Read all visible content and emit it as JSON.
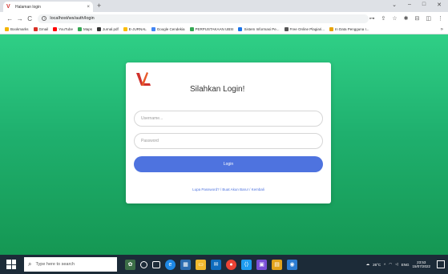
{
  "browser": {
    "tab_title": "Halaman login",
    "tab_close": "×",
    "new_tab": "+",
    "url": "localhost/ws/auth/login",
    "window_controls": [
      "⌄",
      "–",
      "□",
      "✕"
    ],
    "nav": {
      "back": "←",
      "forward": "→",
      "reload": "C"
    },
    "addr_icons": [
      "⊶",
      "⇪",
      "☆",
      "✱",
      "⊟",
      "◫",
      "⋮"
    ]
  },
  "bookmarks": [
    {
      "label": "Bookmarks",
      "color": "#f4b400"
    },
    {
      "label": "Gmail",
      "color": "#d93025"
    },
    {
      "label": "YouTube",
      "color": "#ff0000"
    },
    {
      "label": "Maps",
      "color": "#34a853"
    },
    {
      "label": "Jurnal.pdf",
      "color": "#333333"
    },
    {
      "label": "E-JURNAL",
      "color": "#fbbc04"
    },
    {
      "label": "Google Cendekia",
      "color": "#4285f4"
    },
    {
      "label": "PERPUSTAKAAN UBSI",
      "color": "#34a853"
    },
    {
      "label": "Sistem Informasi Pe...",
      "color": "#1a73e8"
    },
    {
      "label": "Free Online Plagiari...",
      "color": "#555555"
    },
    {
      "label": "In Data Pengguna I...",
      "color": "#e8a400"
    }
  ],
  "bookmarks_more": "»",
  "login": {
    "logo_letter": "V",
    "heading": "Silahkan Login!",
    "username_placeholder": "Username...",
    "password_placeholder": "Password",
    "button_label": "Login",
    "forgot_link": "Lupa Password?",
    "separator": " / ",
    "register_link": "Buat Akun Baru!",
    "back_link": "Kembali"
  },
  "taskbar": {
    "search_placeholder": "Type here to search",
    "weather": "26°C",
    "lang": "ENG",
    "time": "23:53",
    "date": "15/07/2022"
  },
  "colors": {
    "accent": "#4e73df",
    "page_bg_top": "#2fcf86",
    "page_bg_bottom": "#159753"
  }
}
